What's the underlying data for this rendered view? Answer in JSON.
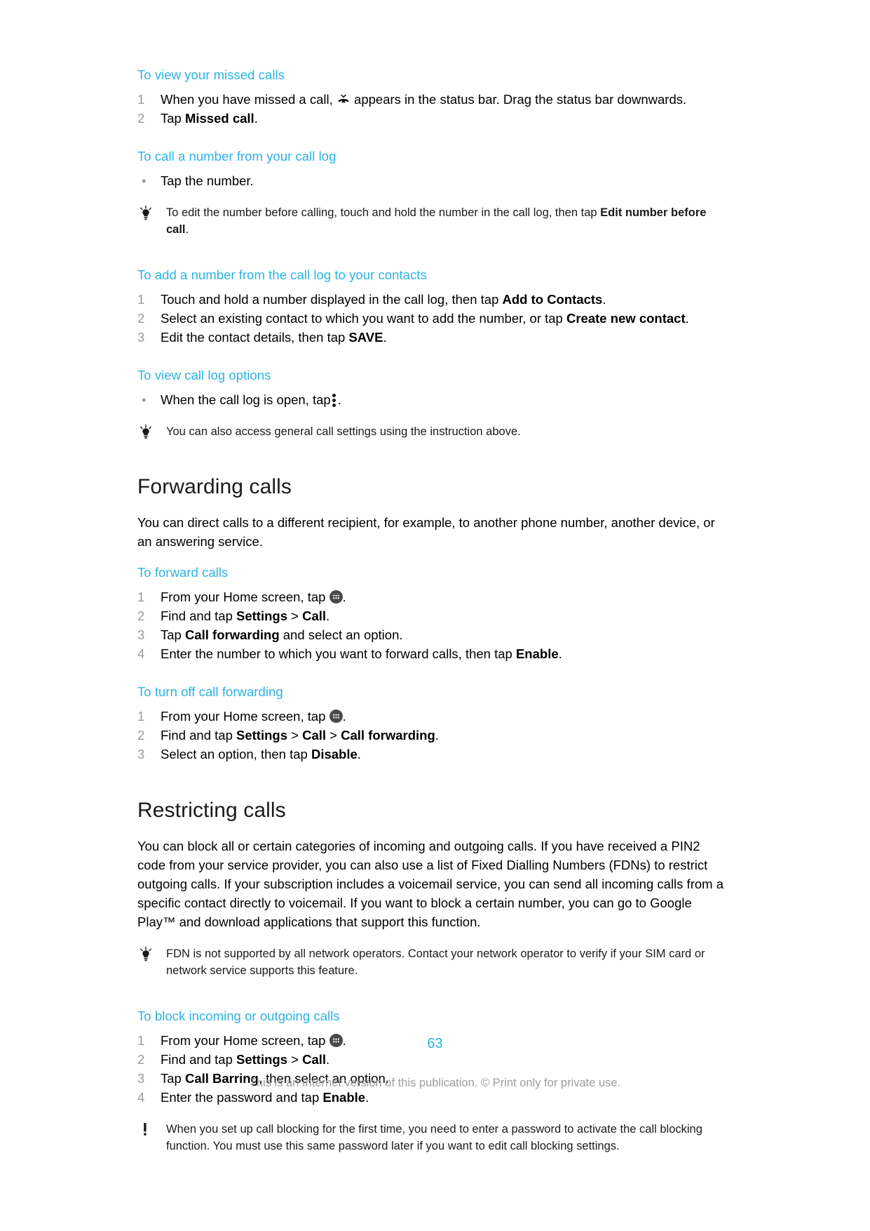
{
  "document": {
    "page_number": "63",
    "footer_note": "This is an Internet version of this publication. © Print only for private use.",
    "accent_color": "#2bb3e4",
    "number_color": "#9a9a9a",
    "footer_color": "#9d9d9d"
  },
  "sections": {
    "missed_calls": {
      "heading": "To view your missed calls",
      "step1_a": "When you have missed a call,",
      "step1_icon": "missed-call-icon",
      "step1_b": "appears in the status bar. Drag the status bar downwards.",
      "step2_a": "Tap ",
      "step2_bold": "Missed call",
      "step2_b": "."
    },
    "call_from_log": {
      "heading": "To call a number from your call log",
      "bullet": "Tap the number.",
      "tip_icon": "lightbulb-tip-icon",
      "tip_a": "To edit the number before calling, touch and hold the number in the call log, then tap ",
      "tip_bold": "Edit number before call",
      "tip_b": "."
    },
    "add_to_contacts": {
      "heading": "To add a number from the call log to your contacts",
      "step1_a": "Touch and hold a number displayed in the call log, then tap ",
      "step1_bold": "Add to Contacts",
      "step1_b": ".",
      "step2_a": "Select an existing contact to which you want to add the number, or tap ",
      "step2_bold": "Create new contact",
      "step2_b": ".",
      "step3_a": "Edit the contact details, then tap ",
      "step3_bold": "SAVE",
      "step3_b": "."
    },
    "call_log_options": {
      "heading": "To view call log options",
      "bullet_a": "When the call log is open, tap",
      "bullet_icon": "more-options-vertical-dots-icon",
      "bullet_b": ".",
      "tip_icon": "lightbulb-tip-icon",
      "tip": "You can also access general call settings using the instruction above."
    },
    "forwarding_calls": {
      "heading": "Forwarding calls",
      "intro": "You can direct calls to a different recipient, for example, to another phone number, another device, or an answering service.",
      "forward": {
        "heading": "To forward calls",
        "step1_a": "From your Home screen, tap",
        "step1_icon": "app-drawer-icon",
        "step1_b": ".",
        "step2_a": "Find and tap ",
        "step2_bold1": "Settings",
        "step2_mid": " > ",
        "step2_bold2": "Call",
        "step2_b": ".",
        "step3_a": "Tap ",
        "step3_bold": "Call forwarding",
        "step3_b": " and select an option.",
        "step4_a": "Enter the number to which you want to forward calls, then tap ",
        "step4_bold": "Enable",
        "step4_b": "."
      },
      "turn_off": {
        "heading": "To turn off call forwarding",
        "step1_a": "From your Home screen, tap",
        "step1_icon": "app-drawer-icon",
        "step1_b": ".",
        "step2_a": "Find and tap ",
        "step2_bold1": "Settings",
        "step2_mid1": " > ",
        "step2_bold2": "Call",
        "step2_mid2": " > ",
        "step2_bold3": "Call forwarding",
        "step2_b": ".",
        "step3_a": "Select an option, then tap ",
        "step3_bold": "Disable",
        "step3_b": "."
      }
    },
    "restricting_calls": {
      "heading": "Restricting calls",
      "intro": "You can block all or certain categories of incoming and outgoing calls. If you have received a PIN2 code from your service provider, you can also use a list of Fixed Dialling Numbers (FDNs) to restrict outgoing calls. If your subscription includes a voicemail service, you can send all incoming calls from a specific contact directly to voicemail. If you want to block a certain number, you can go to Google Play™ and download applications that support this function.",
      "tip_icon": "lightbulb-tip-icon",
      "tip": "FDN is not supported by all network operators. Contact your network operator to verify if your SIM card or network service supports this feature.",
      "block": {
        "heading": "To block incoming or outgoing calls",
        "step1_a": "From your Home screen, tap",
        "step1_icon": "app-drawer-icon",
        "step1_b": ".",
        "step2_a": "Find and tap ",
        "step2_bold1": "Settings",
        "step2_mid": " > ",
        "step2_bold2": "Call",
        "step2_b": ".",
        "step3_a": "Tap ",
        "step3_bold": "Call Barring",
        "step3_b": ", then select an option.",
        "step4_a": "Enter the password and tap ",
        "step4_bold": "Enable",
        "step4_b": "."
      },
      "warning_icon": "exclamation-warning-icon",
      "warning": "When you set up call blocking for the first time, you need to enter a password to activate the call blocking function. You must use this same password later if you want to edit call blocking settings."
    }
  }
}
